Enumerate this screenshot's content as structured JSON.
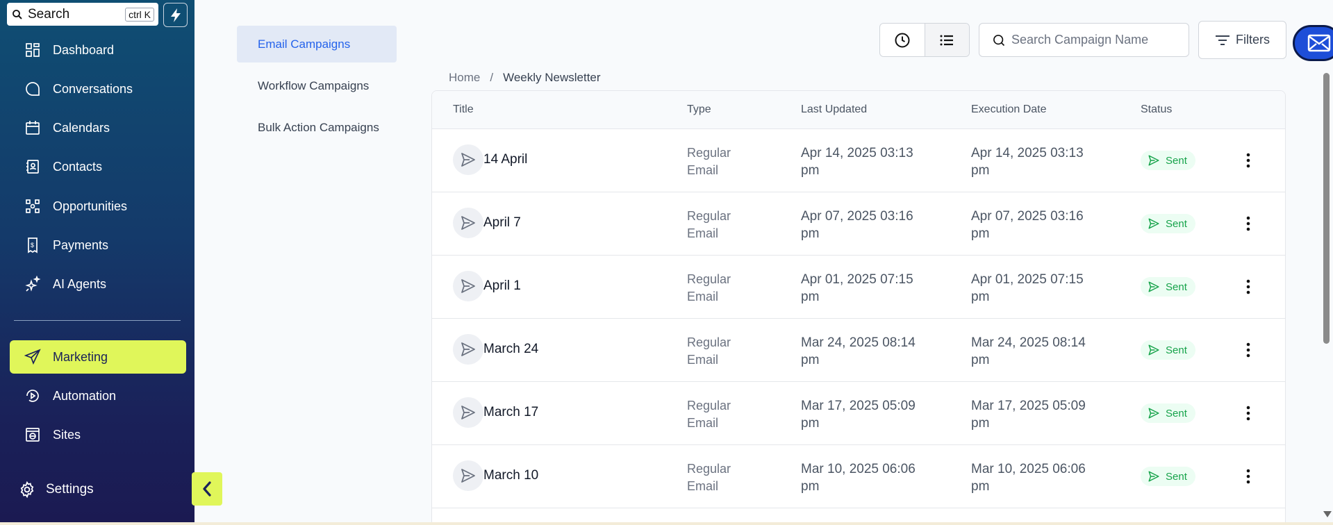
{
  "search": {
    "label": "Search",
    "shortcut": "ctrl K"
  },
  "sidebar": {
    "items": [
      {
        "label": "Dashboard",
        "icon": "dashboard-icon"
      },
      {
        "label": "Conversations",
        "icon": "chat-bubble-icon"
      },
      {
        "label": "Calendars",
        "icon": "calendar-icon"
      },
      {
        "label": "Contacts",
        "icon": "contact-book-icon"
      },
      {
        "label": "Opportunities",
        "icon": "opportunities-icon"
      },
      {
        "label": "Payments",
        "icon": "receipt-icon"
      },
      {
        "label": "AI Agents",
        "icon": "sparkle-icon"
      },
      {
        "label": "Marketing",
        "icon": "send-icon",
        "active": true
      },
      {
        "label": "Automation",
        "icon": "automation-icon"
      },
      {
        "label": "Sites",
        "icon": "globe-icon"
      }
    ],
    "settings_label": "Settings",
    "active_color": "#e0f65a"
  },
  "subnav": {
    "items": [
      {
        "label": "Email Campaigns",
        "active": true
      },
      {
        "label": "Workflow Campaigns"
      },
      {
        "label": "Bulk Action Campaigns"
      }
    ]
  },
  "toolbar": {
    "search_placeholder": "Search Campaign Name",
    "filters_label": "Filters"
  },
  "breadcrumb": {
    "home": "Home",
    "separator": "/",
    "current": "Weekly Newsletter"
  },
  "table": {
    "columns": [
      "Title",
      "Type",
      "Last Updated",
      "Execution Date",
      "Status"
    ],
    "rows": [
      {
        "title": "14 April",
        "type": [
          "Regular",
          "Email"
        ],
        "updated": [
          "Apr 14, 2025 03:13",
          "pm"
        ],
        "executed": [
          "Apr 14, 2025 03:13",
          "pm"
        ],
        "status": "Sent"
      },
      {
        "title": "April 7",
        "type": [
          "Regular",
          "Email"
        ],
        "updated": [
          "Apr 07, 2025 03:16",
          "pm"
        ],
        "executed": [
          "Apr 07, 2025 03:16",
          "pm"
        ],
        "status": "Sent"
      },
      {
        "title": "April 1",
        "type": [
          "Regular",
          "Email"
        ],
        "updated": [
          "Apr 01, 2025 07:15",
          "pm"
        ],
        "executed": [
          "Apr 01, 2025 07:15",
          "pm"
        ],
        "status": "Sent"
      },
      {
        "title": "March 24",
        "type": [
          "Regular",
          "Email"
        ],
        "updated": [
          "Mar 24, 2025 08:14",
          "pm"
        ],
        "executed": [
          "Mar 24, 2025 08:14",
          "pm"
        ],
        "status": "Sent"
      },
      {
        "title": "March 17",
        "type": [
          "Regular",
          "Email"
        ],
        "updated": [
          "Mar 17, 2025 05:09",
          "pm"
        ],
        "executed": [
          "Mar 17, 2025 05:09",
          "pm"
        ],
        "status": "Sent"
      },
      {
        "title": "March 10",
        "type": [
          "Regular",
          "Email"
        ],
        "updated": [
          "Mar 10, 2025 06:06",
          "pm"
        ],
        "executed": [
          "Mar 10, 2025 06:06",
          "pm"
        ],
        "status": "Sent"
      }
    ],
    "status_color": "#16a34a"
  }
}
